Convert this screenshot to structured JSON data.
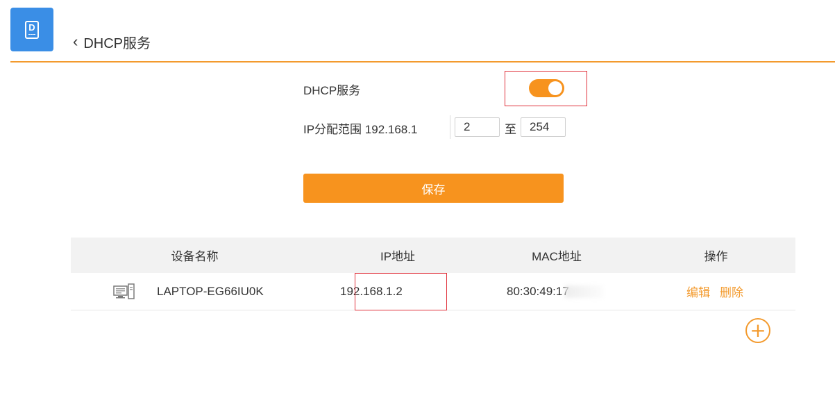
{
  "header": {
    "logo_letter": "D",
    "back_label": "DHCP服务",
    "accent_color": "#f39a2d",
    "logo_color": "#3a8ee6"
  },
  "settings": {
    "dhcp_label": "DHCP服务",
    "dhcp_enabled": true,
    "ip_range_label": "IP分配范围 192.168.1",
    "range_start": "2",
    "range_to_label": "至",
    "range_end": "254",
    "save_label": "保存"
  },
  "table": {
    "headers": [
      "设备名称",
      "IP地址",
      "MAC地址",
      "操作"
    ],
    "rows": [
      {
        "device_name": "LAPTOP-EG66IU0K",
        "ip": "192.168.1.2",
        "mac": "80:30:49:17",
        "edit_label": "编辑",
        "delete_label": "删除"
      }
    ]
  },
  "add_label": "+"
}
